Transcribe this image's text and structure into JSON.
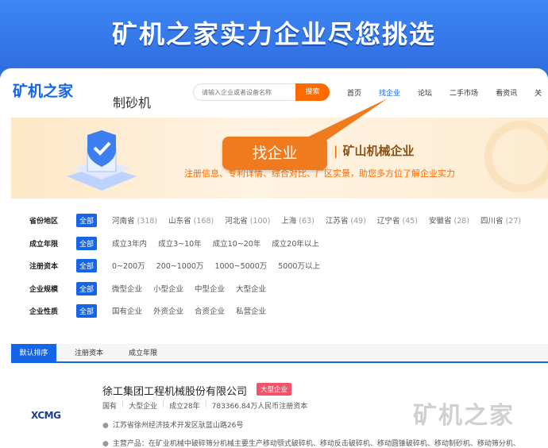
{
  "promo": {
    "title": "矿机之家实力企业尽您挑选"
  },
  "header": {
    "logo": "矿机之家",
    "category_title": "制砂机",
    "search_placeholder": "请输入企业或者设备名称",
    "search_button": "搜索",
    "nav": [
      "首页",
      "找企业",
      "论坛",
      "二手市场",
      "看资讯",
      "关"
    ],
    "nav_active_index": 1
  },
  "hero": {
    "title_sep": "|",
    "title": "矿山机械企业",
    "subtitle": "注册信息、专利详情、综合对比、厂区实景，助您多方位了解企业实力"
  },
  "callout": {
    "label": "找企业"
  },
  "filters": {
    "all_label": "全部",
    "rows": [
      {
        "label": "省份地区",
        "options": [
          {
            "name": "河南省",
            "count": "(318)"
          },
          {
            "name": "山东省",
            "count": "(168)"
          },
          {
            "name": "河北省",
            "count": "(100)"
          },
          {
            "name": "上海",
            "count": "(63)"
          },
          {
            "name": "江苏省",
            "count": "(49)"
          },
          {
            "name": "辽宁省",
            "count": "(45)"
          },
          {
            "name": "安徽省",
            "count": "(28)"
          },
          {
            "name": "四川省",
            "count": "(27)"
          }
        ]
      },
      {
        "label": "成立年限",
        "options": [
          {
            "name": "成立3年内"
          },
          {
            "name": "成立3~10年"
          },
          {
            "name": "成立10~20年"
          },
          {
            "name": "成立20年以上"
          }
        ]
      },
      {
        "label": "注册资本",
        "options": [
          {
            "name": "0~200万"
          },
          {
            "name": "200~1000万"
          },
          {
            "name": "1000~5000万"
          },
          {
            "name": "5000万以上"
          }
        ]
      },
      {
        "label": "企业规模",
        "options": [
          {
            "name": "微型企业"
          },
          {
            "name": "小型企业"
          },
          {
            "name": "中型企业"
          },
          {
            "name": "大型企业"
          }
        ]
      },
      {
        "label": "企业性质",
        "options": [
          {
            "name": "国有企业"
          },
          {
            "name": "外资企业"
          },
          {
            "name": "合资企业"
          },
          {
            "name": "私营企业"
          }
        ]
      }
    ]
  },
  "tabs": [
    {
      "label": "默认排序",
      "active": true
    },
    {
      "label": "注册资本",
      "active": false
    },
    {
      "label": "成立年限",
      "active": false
    }
  ],
  "company": {
    "logo_text": "XCMG",
    "name": "徐工集团工程机械股份有限公司",
    "tag": "大型企业",
    "meta": [
      "国有",
      "大型企业",
      "成立28年",
      "783366.84万人民币注册资本"
    ],
    "address": "江苏省徐州经济技术开发区驮蓝山路26号",
    "products": "主营产品：在矿业机械中破碎筛分机械主要生产移动颚式破碎机、移动反击破碎机、移动圆锥破碎机、移动制砂机、移动筛分机、"
  },
  "watermark": "矿机之家",
  "colors": {
    "brand_blue": "#1565e6",
    "orange": "#ff6a00",
    "tag_red": "#f2536a"
  }
}
